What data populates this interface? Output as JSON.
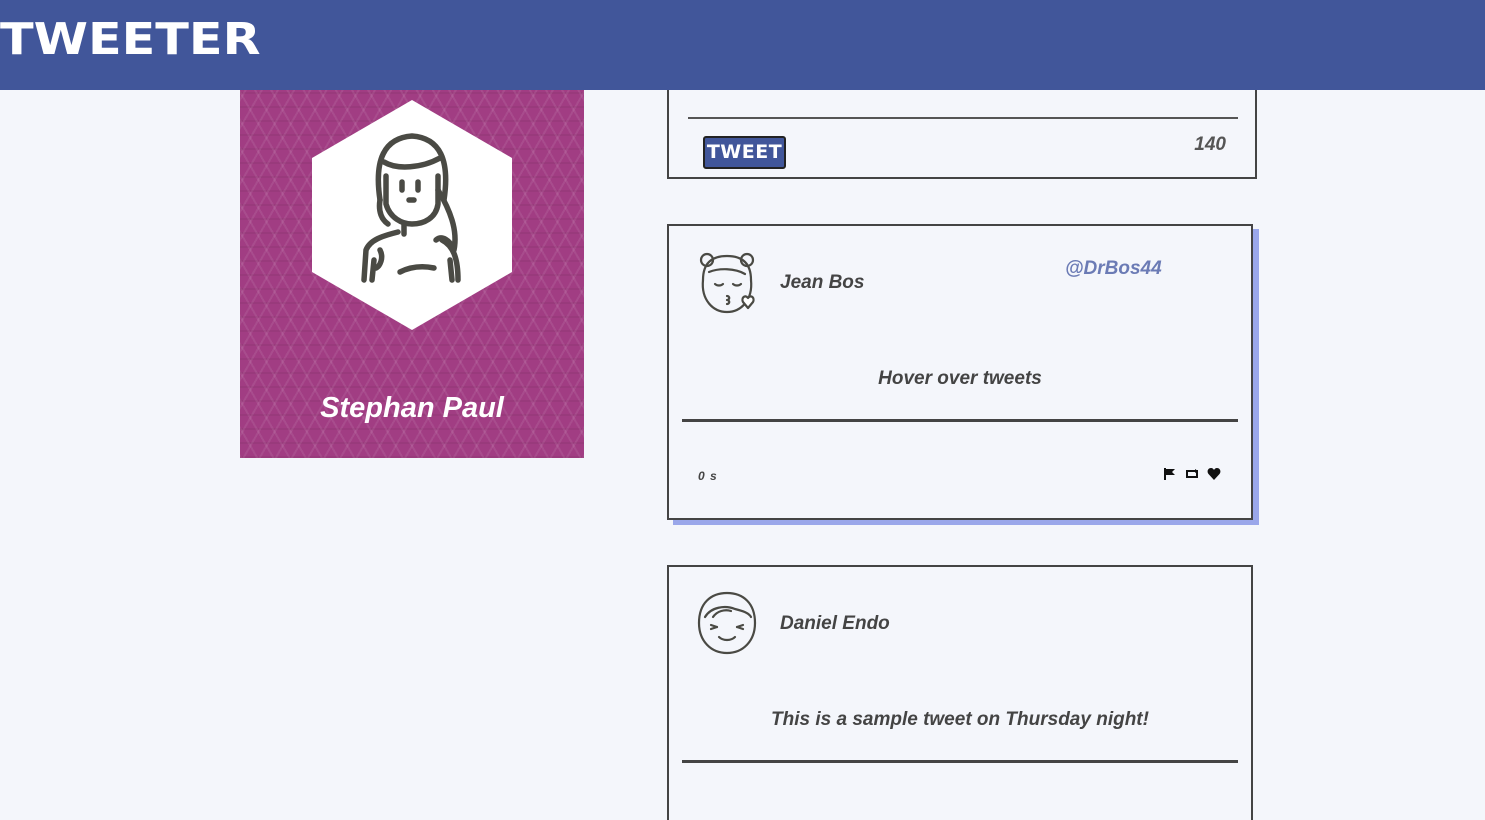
{
  "app": {
    "brand": "TWEETER"
  },
  "profile": {
    "name": "Stephan Paul",
    "card_color": "#a13d83"
  },
  "compose": {
    "button_label": "TWEET",
    "char_count": "140"
  },
  "colors": {
    "accent": "#41569a",
    "hover_shadow": "#9aa7ea",
    "handle": "#6b7bb5"
  },
  "tweets": [
    {
      "author": "Jean Bos",
      "handle": "@DrBos44",
      "text": "Hover over tweets",
      "time": "0 s",
      "actions": [
        "flag-icon",
        "retweet-icon",
        "heart-icon"
      ],
      "avatar_icon": "girl-kiss-avatar-icon"
    },
    {
      "author": "Daniel Endo",
      "text": "This is a sample tweet on Thursday night!",
      "avatar_icon": "boy-smile-avatar-icon"
    }
  ]
}
